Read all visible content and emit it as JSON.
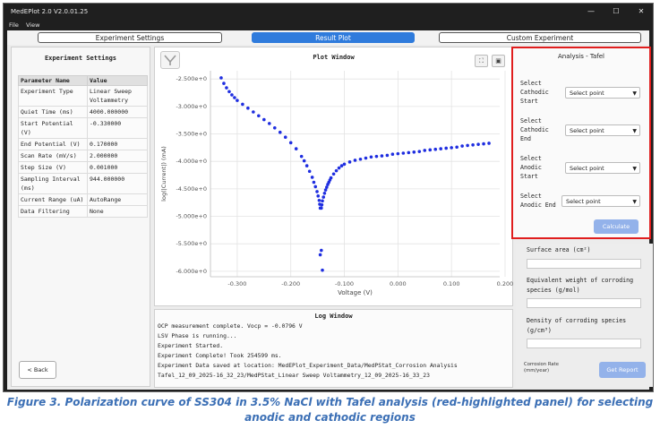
{
  "window": {
    "title": "MedEPlot 2.0 V2.0.01.25",
    "menu": [
      "File",
      "View"
    ],
    "controls": [
      "—",
      "☐",
      "✕"
    ]
  },
  "tabs": [
    {
      "label": "Experiment Settings"
    },
    {
      "label": "Result Plot"
    },
    {
      "label": "Custom Experiment"
    }
  ],
  "settings": {
    "title": "Experiment Settings",
    "col_name": "Parameter Name",
    "col_value": "Value",
    "rows": [
      {
        "name": "Experiment Type",
        "value": "Linear Sweep Voltammetry"
      },
      {
        "name": "Quiet Time (ms)",
        "value": "4000.000000"
      },
      {
        "name": "Start Potential (V)",
        "value": "-0.330000"
      },
      {
        "name": "End Potential (V)",
        "value": "0.170000"
      },
      {
        "name": "Scan Rate (mV/s)",
        "value": "2.000000"
      },
      {
        "name": "Step Size (V)",
        "value": "0.001000"
      },
      {
        "name": "Sampling Interval (ms)",
        "value": "944.000000"
      },
      {
        "name": "Current Range (uA)",
        "value": "AutoRange"
      },
      {
        "name": "Data Filtering",
        "value": "None"
      }
    ],
    "back_label": "< Back"
  },
  "plot": {
    "title": "Plot Window",
    "log_title": "Log Window"
  },
  "chart_data": {
    "type": "scatter",
    "title": "",
    "xlabel": "Voltage (V)",
    "ylabel": "log(|Current|) (mA)",
    "xlim": [
      -0.35,
      0.19
    ],
    "ylim": [
      -6.1,
      -2.35
    ],
    "xticks": [
      -0.3,
      -0.2,
      -0.1,
      0.0,
      0.1,
      0.2
    ],
    "xtick_labels": [
      "-0.300",
      "-0.200",
      "-0.100",
      "0.000",
      "0.100",
      "0.200"
    ],
    "yticks": [
      -2.5,
      -3.0,
      -3.5,
      -4.0,
      -4.5,
      -5.0,
      -5.5,
      -6.0
    ],
    "ytick_labels": [
      "-2.500e+0",
      "-3.000e+0",
      "-3.500e+0",
      "-4.000e+0",
      "-4.500e+0",
      "-5.000e+0",
      "-5.500e+0",
      "-6.000e+0"
    ],
    "grid": true,
    "marker_color": "#1f2ee0",
    "series": [
      {
        "x": [
          -0.33,
          -0.325,
          -0.32,
          -0.315,
          -0.31,
          -0.305,
          -0.3,
          -0.29,
          -0.28,
          -0.27,
          -0.26,
          -0.25,
          -0.24,
          -0.23,
          -0.22,
          -0.21,
          -0.2,
          -0.19,
          -0.18,
          -0.175,
          -0.17,
          -0.165,
          -0.16,
          -0.157,
          -0.154,
          -0.151,
          -0.149,
          -0.147,
          -0.146,
          -0.145,
          -0.143,
          -0.142,
          -0.141,
          -0.139,
          -0.137,
          -0.135,
          -0.133,
          -0.131,
          -0.129,
          -0.127,
          -0.125,
          -0.12,
          -0.115,
          -0.11,
          -0.105,
          -0.1,
          -0.09,
          -0.08,
          -0.07,
          -0.06,
          -0.05,
          -0.04,
          -0.03,
          -0.02,
          -0.01,
          0.0,
          0.01,
          0.02,
          0.03,
          0.04,
          0.05,
          0.06,
          0.07,
          0.08,
          0.09,
          0.1,
          0.11,
          0.12,
          0.13,
          0.14,
          0.15,
          0.16,
          0.17,
          -0.145,
          -0.143,
          -0.141
        ],
        "y": [
          -2.48,
          -2.58,
          -2.66,
          -2.73,
          -2.79,
          -2.84,
          -2.89,
          -2.96,
          -3.03,
          -3.1,
          -3.17,
          -3.24,
          -3.31,
          -3.39,
          -3.47,
          -3.56,
          -3.66,
          -3.77,
          -3.91,
          -3.99,
          -4.08,
          -4.18,
          -4.29,
          -4.38,
          -4.46,
          -4.55,
          -4.63,
          -4.71,
          -4.78,
          -4.85,
          -4.85,
          -4.79,
          -4.72,
          -4.65,
          -4.58,
          -4.52,
          -4.47,
          -4.42,
          -4.38,
          -4.34,
          -4.3,
          -4.23,
          -4.17,
          -4.12,
          -4.08,
          -4.05,
          -4.01,
          -3.98,
          -3.96,
          -3.94,
          -3.92,
          -3.91,
          -3.9,
          -3.89,
          -3.87,
          -3.86,
          -3.85,
          -3.84,
          -3.83,
          -3.82,
          -3.8,
          -3.79,
          -3.78,
          -3.77,
          -3.76,
          -3.75,
          -3.74,
          -3.72,
          -3.71,
          -3.7,
          -3.69,
          -3.68,
          -3.67,
          -5.7,
          -5.62,
          -5.98
        ]
      }
    ]
  },
  "log": {
    "lines": [
      "OCP measurement complete. Vocp = -0.0796 V",
      "LSV Phase is running...",
      "Experiment Started.",
      "Experiment Complete! Took 254599 ms.",
      "Experiment Data saved at location: MedEPlot_Experiment_Data/MedPStat_Corrosion Analysis",
      "Tafel_12_09_2025-16_32_23/MedPStat_Linear Sweep Voltammetry_12_09_2025-16_33_23"
    ]
  },
  "analysis": {
    "title": "Analysis - Tafel",
    "rows": [
      {
        "label_lines": [
          "Select",
          "Cathodic",
          "Start"
        ],
        "select": "Select point"
      },
      {
        "label_lines": [
          "Select",
          "Cathodic",
          "End"
        ],
        "select": "Select point"
      },
      {
        "label_lines": [
          "Select",
          "Anodic",
          "Start"
        ],
        "select": "Select point"
      },
      {
        "label_lines": [
          "Select",
          "Anodic End"
        ],
        "select": "Select point"
      }
    ],
    "calculate_label": "Calculate",
    "highlight_color": "#e01e1e"
  },
  "extra": {
    "surface_area_label": "Surface area (cm²)",
    "equiv_weight_label": "Equivalent weight of corroding species (g/mol)",
    "density_label": "Density of corroding species (g/cm³)",
    "corrosion_rate_label": "Corrosion Rate (mm/year)",
    "get_report_label": "Get Report"
  },
  "caption": "Figure 3. Polarization curve of SS304 in 3.5% NaCl with Tafel analysis (red-highlighted panel) for selecting anodic and cathodic regions"
}
